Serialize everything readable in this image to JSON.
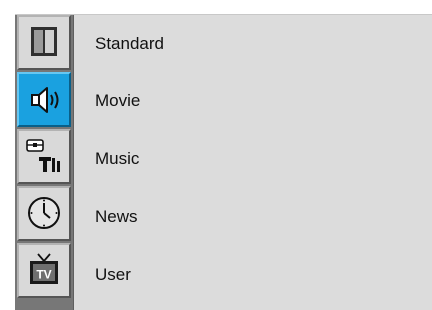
{
  "menu": {
    "items": [
      {
        "label": "Standard"
      },
      {
        "label": "Movie"
      },
      {
        "label": "Music"
      },
      {
        "label": "News"
      },
      {
        "label": "User"
      }
    ]
  },
  "sidebar": {
    "buttons": [
      {
        "icon": "picture-icon",
        "active": false
      },
      {
        "icon": "speaker-icon",
        "active": true
      },
      {
        "icon": "tools-icon",
        "active": false
      },
      {
        "icon": "clock-icon",
        "active": false
      },
      {
        "icon": "tv-icon",
        "active": false
      }
    ],
    "tv_icon_text": "TV"
  },
  "colors": {
    "active_blue": "#1aa1e0",
    "panel_bg": "#dcdcdc",
    "sidebar_bg": "#777777"
  }
}
